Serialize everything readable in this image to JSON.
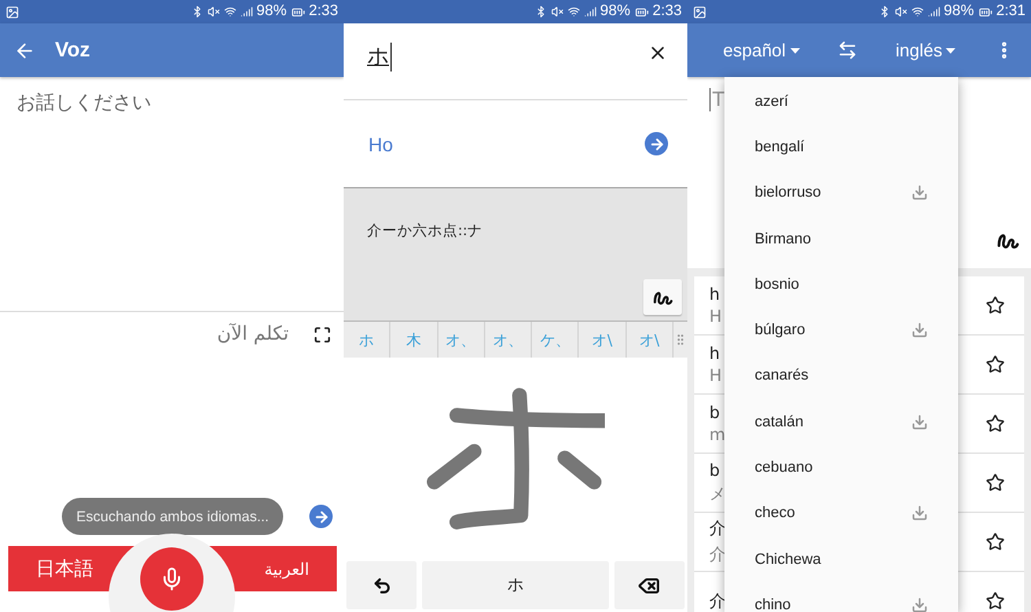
{
  "voice_screen": {
    "status_bar": {
      "notification": true,
      "battery": "98%",
      "time": "2:33"
    },
    "app_bar": {
      "title": "Voz"
    },
    "prompt": "お話しください",
    "translation_prompt": "تكلم الآن",
    "toast": "Escuchando ambos idiomas...",
    "languages": {
      "left": "日本語",
      "right": "العربية"
    }
  },
  "handwriting_screen": {
    "status_bar": {
      "notification": false,
      "battery": "98%",
      "time": "2:33"
    },
    "input": {
      "value": "ホ"
    },
    "suggestion": "Ho",
    "recognized_text": "介ーか六ホ点::ナ",
    "candidates": [
      {
        "label": "ホ"
      },
      {
        "label": "木"
      },
      {
        "label": "オ、"
      },
      {
        "label": "オ、"
      },
      {
        "label": "ケ、"
      },
      {
        "label": "オ\\"
      },
      {
        "label": "オ\\"
      }
    ],
    "keys": {
      "space_label": "ホ"
    }
  },
  "language_screen": {
    "status_bar": {
      "notification": true,
      "battery": "98%",
      "time": "2:31"
    },
    "source_language": "español",
    "target_language": "inglés",
    "input_placeholder": "T",
    "history": [
      {
        "title": "h",
        "subtitle": "H"
      },
      {
        "title": "h",
        "subtitle": "H"
      },
      {
        "title": "b",
        "subtitle": "m"
      },
      {
        "title": "b",
        "subtitle": "メ"
      },
      {
        "title": "介",
        "subtitle": "介"
      },
      {
        "title": "介"
      }
    ],
    "menu": [
      {
        "label": "azerí",
        "downloadable": false
      },
      {
        "label": "bengalí",
        "downloadable": false
      },
      {
        "label": "bielorruso",
        "downloadable": true
      },
      {
        "label": "Birmano",
        "downloadable": false
      },
      {
        "label": "bosnio",
        "downloadable": false
      },
      {
        "label": "búlgaro",
        "downloadable": true
      },
      {
        "label": "canarés",
        "downloadable": false
      },
      {
        "label": "catalán",
        "downloadable": true
      },
      {
        "label": "cebuano",
        "downloadable": false
      },
      {
        "label": "checo",
        "downloadable": true
      },
      {
        "label": "Chichewa",
        "downloadable": false
      },
      {
        "label": "chino",
        "downloadable": true
      }
    ]
  }
}
